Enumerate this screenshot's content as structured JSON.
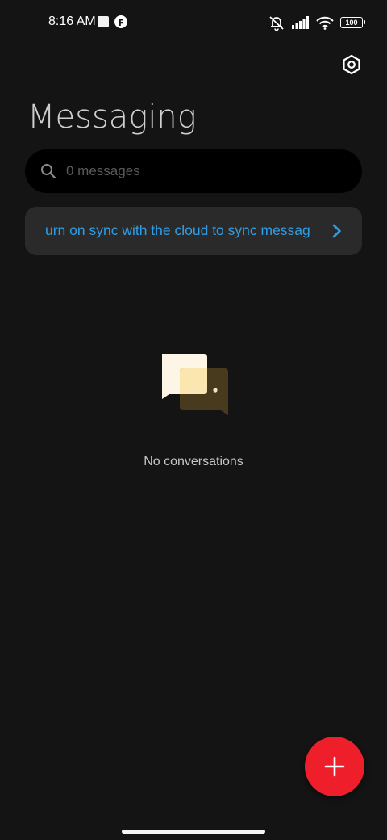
{
  "status_bar": {
    "time": "8:16 AM",
    "battery": "100"
  },
  "header": {
    "title": "Messaging",
    "settings_icon": "settings-hexagon-icon"
  },
  "search": {
    "placeholder": "0 messages",
    "value": ""
  },
  "sync_banner": {
    "text": "urn on sync with the cloud to sync messag",
    "link_color": "#2f9ee6"
  },
  "empty_state": {
    "icon": "chat-bubbles-icon",
    "text": "No conversations"
  },
  "fab": {
    "icon": "plus-icon",
    "color": "#ee1f2a"
  },
  "colors": {
    "background": "#141414",
    "surface": "#2a2a2a",
    "search_background": "#000000"
  }
}
